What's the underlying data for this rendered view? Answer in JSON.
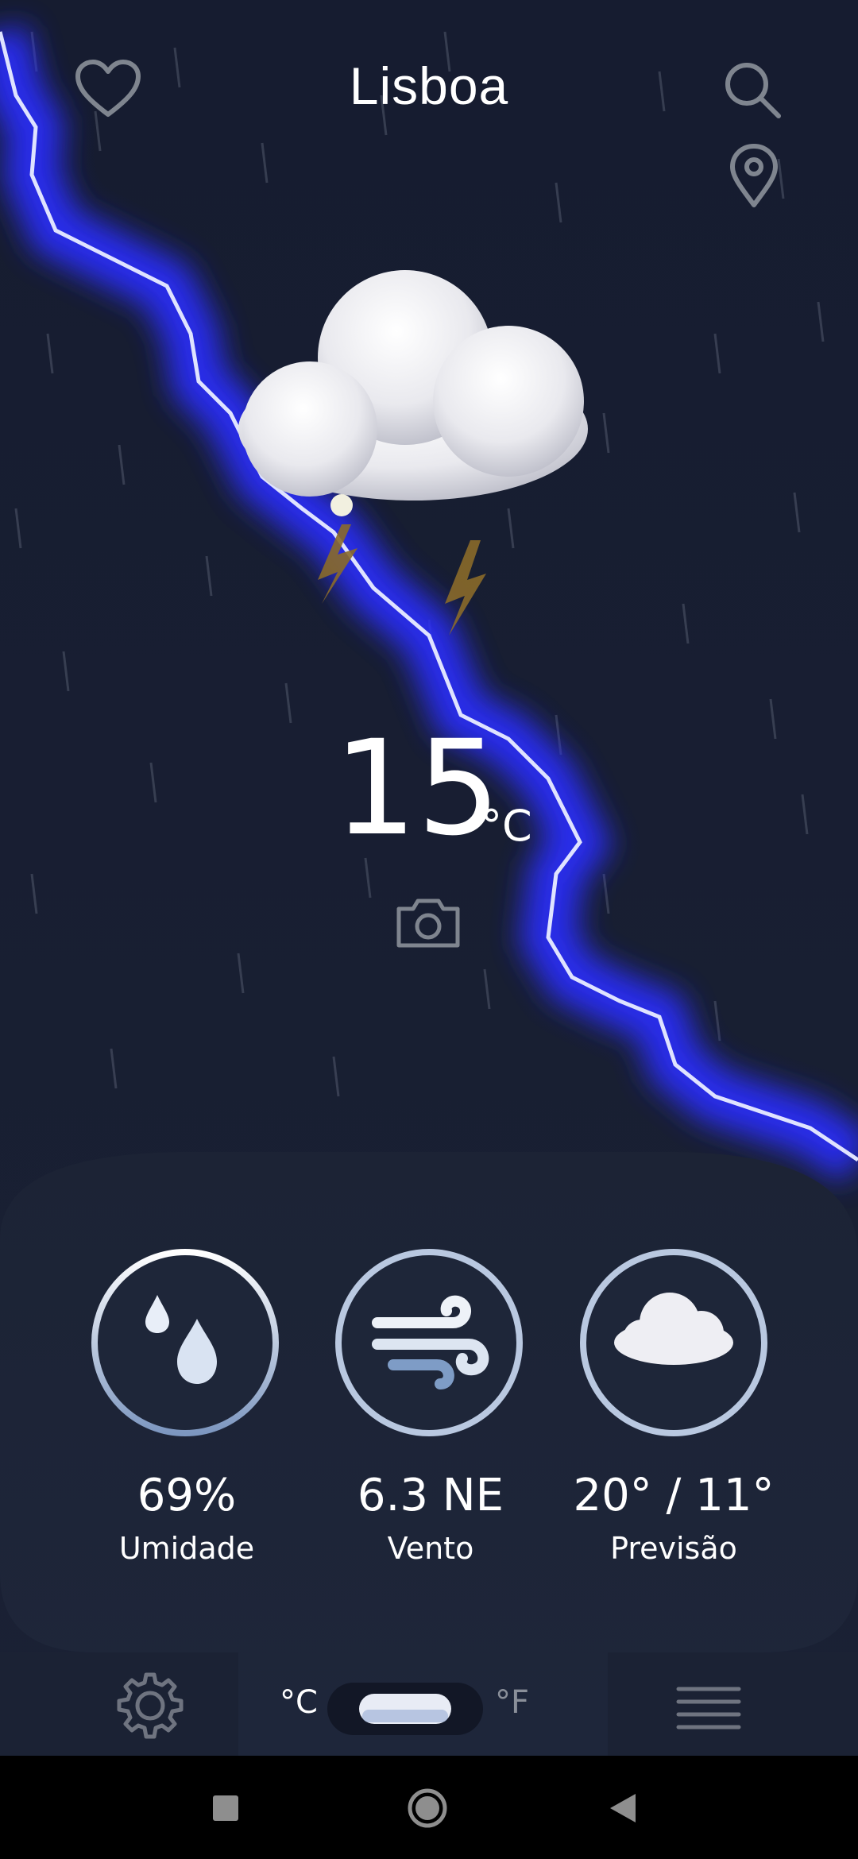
{
  "app": {
    "city": "Lisboa",
    "temperature": "15",
    "temperature_unit": "°C"
  },
  "icons": {
    "favorite": "heart-icon",
    "search": "search-icon",
    "location": "location-pin-icon",
    "weather": "thunderstorm-cloud-icon",
    "camera": "camera-icon",
    "settings": "gear-icon",
    "menu": "menu-icon"
  },
  "stats": [
    {
      "value": "69%",
      "label": "Umidade",
      "icon": "humidity-drops-icon"
    },
    {
      "value": "6.3 NE",
      "label": "Vento",
      "icon": "wind-icon"
    },
    {
      "value": "20° / 11°",
      "label": "Previsão",
      "icon": "cloud-icon"
    }
  ],
  "units": {
    "celsius": "°C",
    "fahrenheit": "°F",
    "selected": "celsius"
  },
  "colors": {
    "background": "#141a2e",
    "lightning_glow": "#2a2cff",
    "panel": "#1b2336",
    "accent_bolt": "#8a6a2a"
  }
}
